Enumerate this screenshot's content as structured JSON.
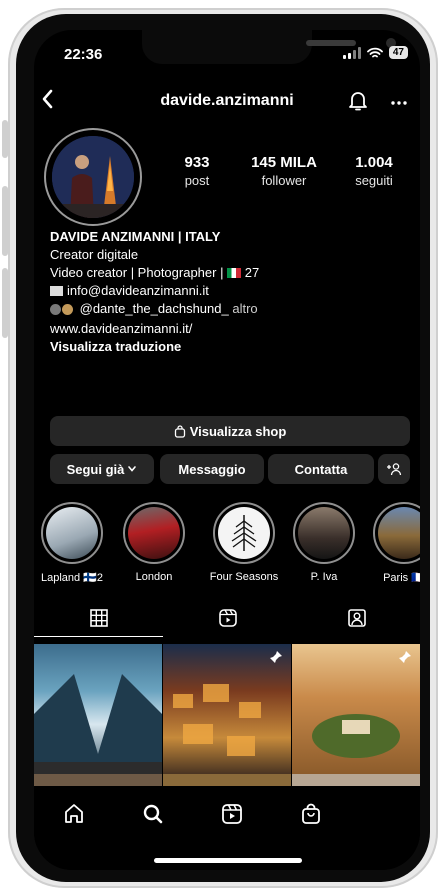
{
  "status_bar": {
    "time": "22:36",
    "battery": "47"
  },
  "header": {
    "username": "davide.anzimanni"
  },
  "stats": [
    {
      "value": "933",
      "label": "post"
    },
    {
      "value": "145 MILA",
      "label": "follower"
    },
    {
      "value": "1.004",
      "label": "seguiti"
    }
  ],
  "bio": {
    "name": "DAVIDE ANZIMANNI | ITALY",
    "category": "Creator digitale",
    "line1": "Video creator | Photographer |",
    "line1_suffix": "27",
    "email": "info@davideanzimanni.it",
    "mention": "@dante_the_dachshund_",
    "mention_suffix": "altro",
    "website": "www.davideanzimanni.it/",
    "translate": "Visualizza traduzione"
  },
  "buttons": {
    "shop": "Visualizza shop",
    "follow": "Segui già",
    "message": "Messaggio",
    "contact": "Contatta"
  },
  "highlights": [
    {
      "label": "Lapland 🇫🇮2"
    },
    {
      "label": "London"
    },
    {
      "label": "Four Seasons"
    },
    {
      "label": "P. Iva"
    },
    {
      "label": "Paris 🇫🇷"
    }
  ],
  "icons": {
    "back": "chevron-left-icon",
    "bell": "bell-icon",
    "more": "more-icon",
    "grid": "grid-icon",
    "reels": "reels-icon",
    "tagged": "tagged-icon",
    "home": "home-icon",
    "search": "search-icon",
    "shop": "shopping-bag-icon"
  }
}
